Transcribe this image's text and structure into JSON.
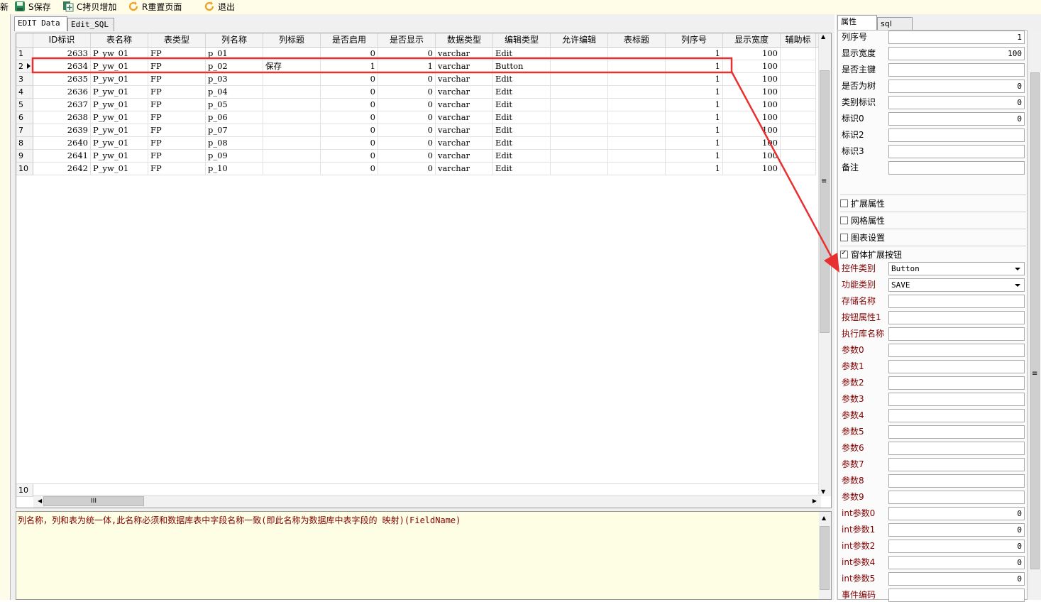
{
  "toolbar": {
    "new_label": "新",
    "save_label": "S保存",
    "copy_add_label": "C拷贝增加",
    "reset_label": "R重置页面",
    "exit_label": "退出"
  },
  "tabs": [
    {
      "label": "EDIT Data",
      "active": true
    },
    {
      "label": "Edit_SQL",
      "active": false
    }
  ],
  "grid": {
    "columns": [
      "ID标识",
      "表名称",
      "表类型",
      "列名称",
      "列标题",
      "是否启用",
      "是否显示",
      "数据类型",
      "编辑类型",
      "允许编辑",
      "表标题",
      "列序号",
      "显示宽度",
      "辅助标"
    ],
    "rows": [
      {
        "no": "1",
        "cells": [
          "2633",
          "P_yw_01",
          "FP",
          "p_01",
          "",
          "0",
          "0",
          "varchar",
          "Edit",
          "",
          "",
          "1",
          "100",
          ""
        ]
      },
      {
        "no": "2",
        "cells": [
          "2634",
          "P_yw_01",
          "FP",
          "p_02",
          "保存",
          "1",
          "1",
          "varchar",
          "Button",
          "",
          "",
          "1",
          "100",
          ""
        ],
        "current": true
      },
      {
        "no": "3",
        "cells": [
          "2635",
          "P_yw_01",
          "FP",
          "p_03",
          "",
          "0",
          "0",
          "varchar",
          "Edit",
          "",
          "",
          "1",
          "100",
          ""
        ]
      },
      {
        "no": "4",
        "cells": [
          "2636",
          "P_yw_01",
          "FP",
          "p_04",
          "",
          "0",
          "0",
          "varchar",
          "Edit",
          "",
          "",
          "1",
          "100",
          ""
        ]
      },
      {
        "no": "5",
        "cells": [
          "2637",
          "P_yw_01",
          "FP",
          "p_05",
          "",
          "0",
          "0",
          "varchar",
          "Edit",
          "",
          "",
          "1",
          "100",
          ""
        ]
      },
      {
        "no": "6",
        "cells": [
          "2638",
          "P_yw_01",
          "FP",
          "p_06",
          "",
          "0",
          "0",
          "varchar",
          "Edit",
          "",
          "",
          "1",
          "100",
          ""
        ]
      },
      {
        "no": "7",
        "cells": [
          "2639",
          "P_yw_01",
          "FP",
          "p_07",
          "",
          "0",
          "0",
          "varchar",
          "Edit",
          "",
          "",
          "1",
          "100",
          ""
        ]
      },
      {
        "no": "8",
        "cells": [
          "2640",
          "P_yw_01",
          "FP",
          "p_08",
          "",
          "0",
          "0",
          "varchar",
          "Edit",
          "",
          "",
          "1",
          "100",
          ""
        ]
      },
      {
        "no": "9",
        "cells": [
          "2641",
          "P_yw_01",
          "FP",
          "p_09",
          "",
          "0",
          "0",
          "varchar",
          "Edit",
          "",
          "",
          "1",
          "100",
          ""
        ]
      },
      {
        "no": "10",
        "cells": [
          "2642",
          "P_yw_01",
          "FP",
          "p_10",
          "",
          "0",
          "0",
          "varchar",
          "Edit",
          "",
          "",
          "1",
          "100",
          ""
        ]
      }
    ],
    "footer_count": "10",
    "hscroll_grip": "III",
    "vscroll_grip": "≡"
  },
  "help_text": "列名称，列和表为统一体,此名称必须和数据库表中字段名称一致(即此名称为数据库中表字段的 映射)(FieldName)",
  "panel": {
    "tabs": [
      "属性",
      "sql"
    ],
    "basic": [
      {
        "label": "列序号",
        "value": "1"
      },
      {
        "label": "显示宽度",
        "value": "100"
      },
      {
        "label": "是否主键",
        "value": ""
      },
      {
        "label": "是否为树",
        "value": "0"
      },
      {
        "label": "类别标识",
        "value": "0"
      },
      {
        "label": "标识0",
        "value": "0"
      },
      {
        "label": "标识2",
        "value": ""
      },
      {
        "label": "标识3",
        "value": ""
      },
      {
        "label": "备注",
        "value": ""
      }
    ],
    "groups": [
      {
        "label": "扩展属性",
        "checked": false
      },
      {
        "label": "网格属性",
        "checked": false
      },
      {
        "label": "图表设置",
        "checked": false
      },
      {
        "label": "窗体扩展按钮",
        "checked": true
      }
    ],
    "ext": [
      {
        "label": "控件类别",
        "value": "Button",
        "select": true
      },
      {
        "label": "功能类别",
        "value": "SAVE",
        "select": true
      },
      {
        "label": "存储名称",
        "value": ""
      },
      {
        "label": "按钮属性1",
        "value": ""
      },
      {
        "label": "执行库名称",
        "value": ""
      },
      {
        "label": "参数0",
        "value": ""
      },
      {
        "label": "参数1",
        "value": ""
      },
      {
        "label": "参数2",
        "value": ""
      },
      {
        "label": "参数3",
        "value": ""
      },
      {
        "label": "参数4",
        "value": ""
      },
      {
        "label": "参数5",
        "value": ""
      },
      {
        "label": "参数6",
        "value": ""
      },
      {
        "label": "参数7",
        "value": ""
      },
      {
        "label": "参数8",
        "value": ""
      },
      {
        "label": "参数9",
        "value": ""
      },
      {
        "label": "int参数0",
        "value": "0"
      },
      {
        "label": "int参数1",
        "value": "0"
      },
      {
        "label": "int参数2",
        "value": "0"
      },
      {
        "label": "int参数4",
        "value": "0"
      },
      {
        "label": "int参数5",
        "value": "0"
      },
      {
        "label": "事件编码",
        "value": ""
      }
    ],
    "vscroll_grip": "≡"
  },
  "colors": {
    "highlight_box": "#e83030",
    "arrow": "#e83030",
    "label_dark_red": "#800000",
    "help_bg": "#fefee4"
  }
}
